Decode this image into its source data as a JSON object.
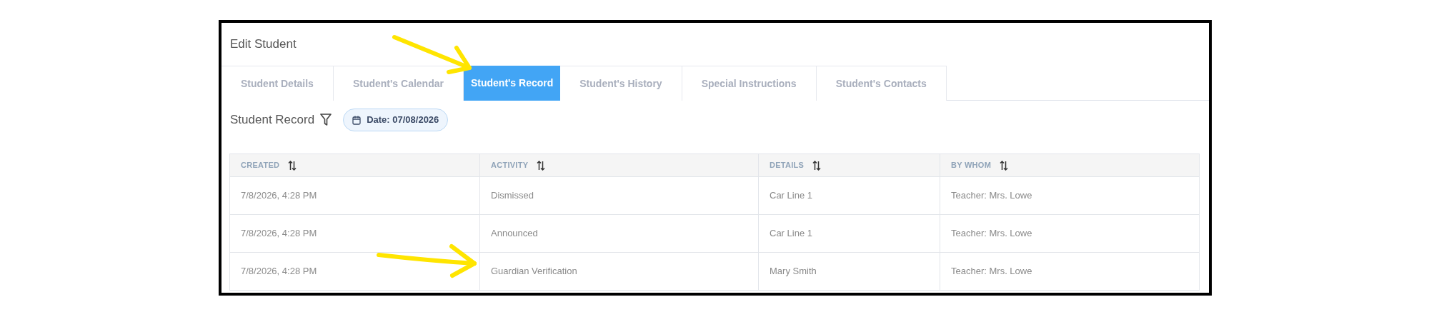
{
  "window": {
    "title": "Edit Student"
  },
  "tabs": [
    {
      "label": "Student Details",
      "selected": false
    },
    {
      "label": "Student's Calendar",
      "selected": false
    },
    {
      "label": "Student's Record",
      "selected": true
    },
    {
      "label": "Student's History",
      "selected": false
    },
    {
      "label": "Special Instructions",
      "selected": false
    },
    {
      "label": "Student's Contacts",
      "selected": false
    }
  ],
  "section": {
    "title": "Student Record",
    "date_chip": "Date: 07/08/2026"
  },
  "table": {
    "columns": [
      "CREATED",
      "ACTIVITY",
      "DETAILS",
      "BY WHOM"
    ],
    "rows": [
      [
        "7/8/2026, 4:28 PM",
        "Dismissed",
        "Car Line 1",
        "Teacher: Mrs. Lowe"
      ],
      [
        "7/8/2026, 4:28 PM",
        "Announced",
        "Car Line 1",
        "Teacher: Mrs. Lowe"
      ],
      [
        "7/8/2026, 4:28 PM",
        "Guardian Verification",
        "Mary Smith",
        "Teacher: Mrs. Lowe"
      ]
    ]
  }
}
